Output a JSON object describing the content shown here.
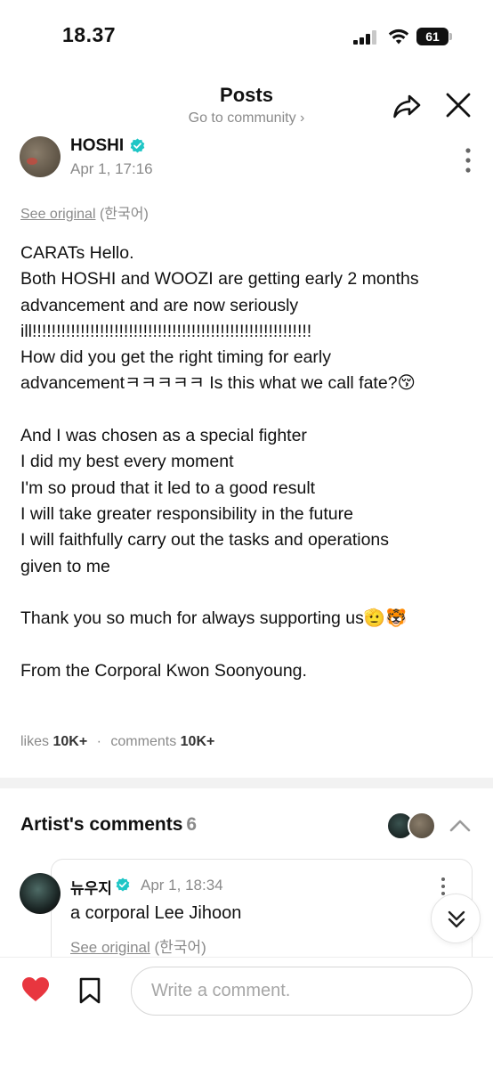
{
  "status_bar": {
    "time": "18.37",
    "battery_level": "61"
  },
  "header": {
    "title": "Posts",
    "community_link": "Go to community ›"
  },
  "post": {
    "author": "HOSHI",
    "date": "Apr 1, 17:16",
    "see_original": "See original",
    "original_language": "(한국어)",
    "body_lines": [
      "CARATs Hello.",
      "Both HOSHI and WOOZI are getting early 2 months",
      "advancement and are now seriously",
      "ill!!!!!!!!!!!!!!!!!!!!!!!!!!!!!!!!!!!!!!!!!!!!!!!!!!!!!!!!!!",
      "How did you get the right timing for early",
      "advancementㅋㅋㅋㅋㅋ Is this what we call fate?😚",
      "",
      "And I was chosen as a special fighter",
      "I did my best every moment",
      "I'm so proud that it led to a good result",
      "I will take greater responsibility in the future",
      "I will faithfully carry out the tasks and operations",
      "given to me",
      "",
      "Thank you so much for always supporting us🫡🐯",
      "",
      "From the Corporal Kwon Soonyoung."
    ],
    "likes_label": "likes",
    "likes_count": "10K+",
    "comments_label": "comments",
    "comments_count": "10K+"
  },
  "artist_comments": {
    "title": "Artist's comments",
    "count": "6",
    "items": [
      {
        "author": "뉴우지",
        "date": "Apr 1, 18:34",
        "text": "a corporal Lee Jihoon",
        "see_original": "See original",
        "original_language": "(한국어)"
      }
    ]
  },
  "bottom_bar": {
    "comment_placeholder": "Write a comment."
  },
  "colors": {
    "verified_badge": "#1fc6c6",
    "like_heart": "#e8363f",
    "muted_text": "#8a8a8a"
  },
  "icons": [
    "signal-icon",
    "wifi-icon",
    "battery-icon",
    "share-icon",
    "close-icon",
    "verified-icon",
    "more-icon",
    "chevron-up-icon",
    "double-chevron-down-icon",
    "heart-icon",
    "bookmark-icon"
  ]
}
